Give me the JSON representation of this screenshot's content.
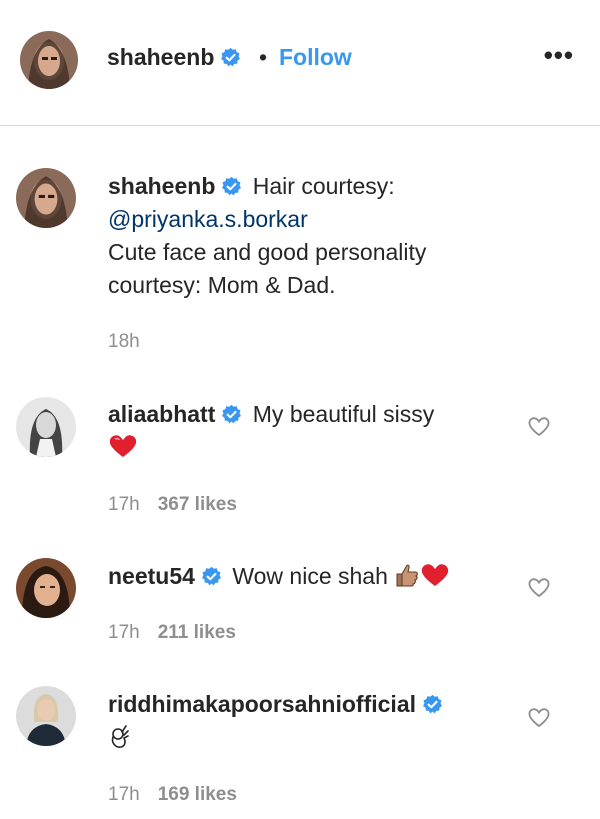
{
  "post_header": {
    "username": "shaheenb",
    "separator": "•",
    "follow_label": "Follow",
    "more_label": "•••"
  },
  "caption": {
    "username": "shaheenb",
    "line1": "Hair courtesy:",
    "mention": "@priyanka.s.borkar",
    "line2": "Cute face and good personality",
    "line3": "courtesy: Mom & Dad.",
    "time": "18h"
  },
  "comments": [
    {
      "username": "aliaabhatt",
      "text": "My beautiful sissy",
      "emoji": "red-heart",
      "time": "17h",
      "likes": "367 likes"
    },
    {
      "username": "neetu54",
      "text": "Wow nice shah",
      "emoji": "thumbs-up heart",
      "time": "17h",
      "likes": "211 likes"
    },
    {
      "username": "riddhimakapoorsahniofficial",
      "text": "",
      "emoji": "ok-hand",
      "time": "17h",
      "likes": "169 likes"
    }
  ],
  "colors": {
    "link_blue": "#3897f0",
    "mention_blue": "#003569",
    "text": "#262626",
    "meta_gray": "#8e8e8e",
    "divider": "#dbdbdb"
  }
}
